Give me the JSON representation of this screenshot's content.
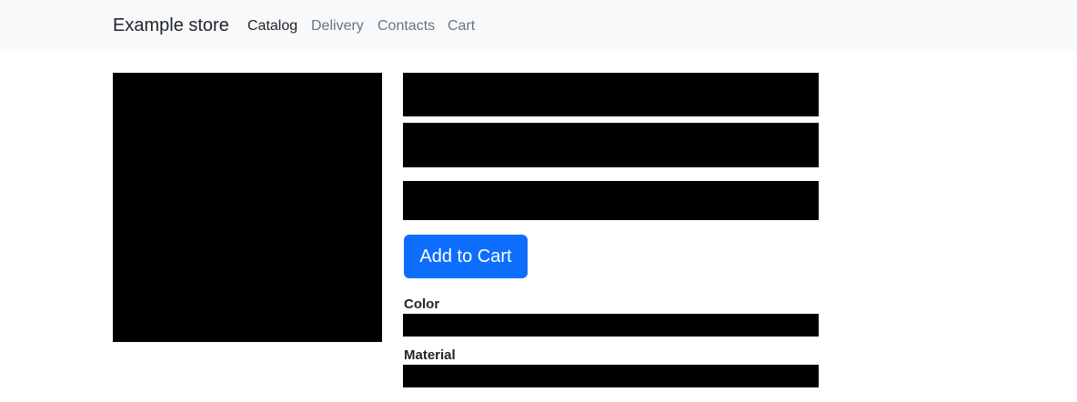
{
  "navbar": {
    "brand": "Example store",
    "links": [
      {
        "label": "Catalog",
        "active": true
      },
      {
        "label": "Delivery",
        "active": false
      },
      {
        "label": "Contacts",
        "active": false
      },
      {
        "label": "Cart",
        "active": false
      }
    ]
  },
  "product": {
    "add_to_cart_label": "Add to Cart",
    "attributes": [
      {
        "label": "Color"
      },
      {
        "label": "Material"
      }
    ]
  },
  "colors": {
    "navbar_bg": "#f8f9fa",
    "primary": "#0d6efd",
    "redaction": "#000000"
  }
}
